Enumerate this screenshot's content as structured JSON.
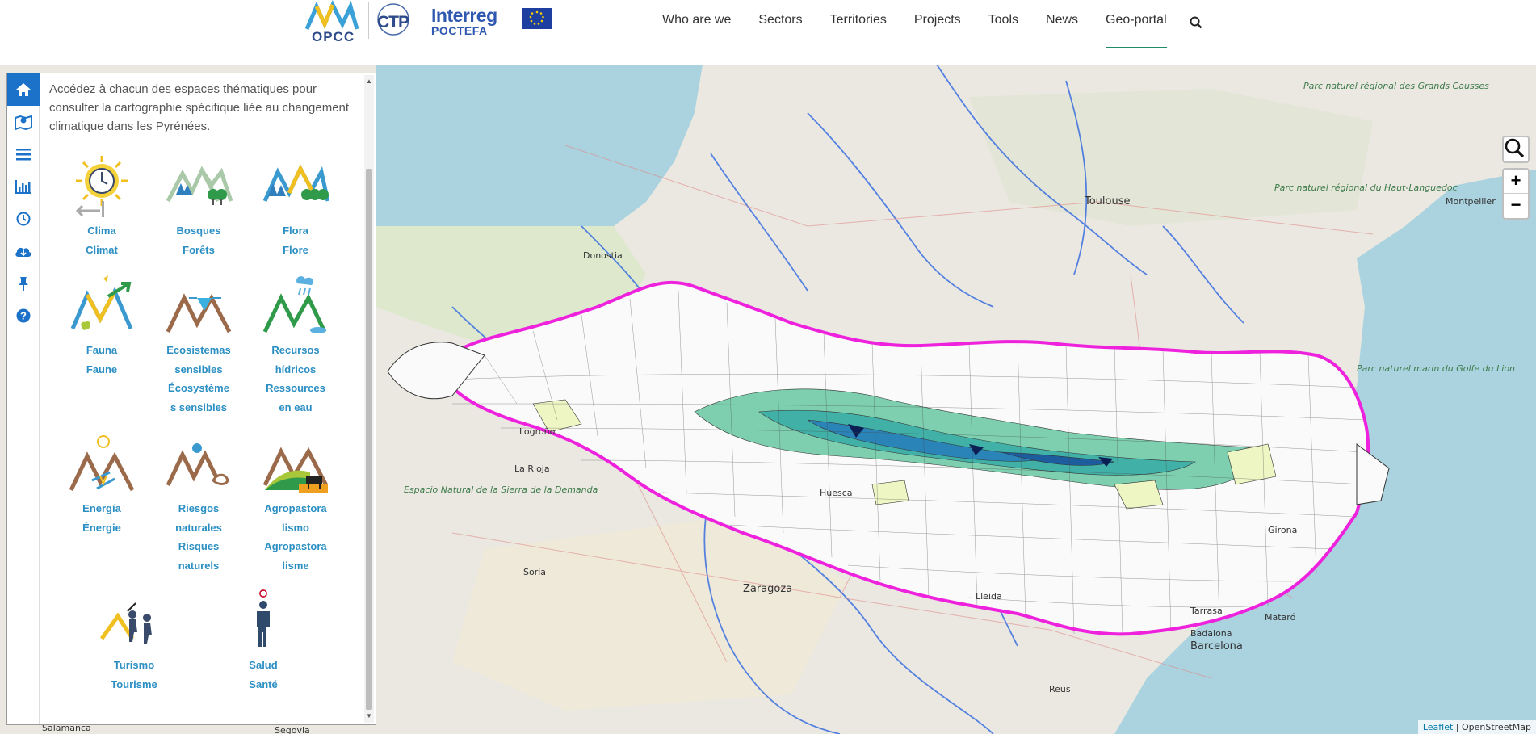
{
  "header": {
    "logo_opcc": "OPCC",
    "logo_ctp": "CTP",
    "logo_interreg_1": "Interreg",
    "logo_interreg_2": "POCTEFA",
    "nav": [
      {
        "label": "Who are we"
      },
      {
        "label": "Sectors"
      },
      {
        "label": "Territories"
      },
      {
        "label": "Projects"
      },
      {
        "label": "Tools"
      },
      {
        "label": "News"
      },
      {
        "label": "Geo-portal"
      }
    ],
    "active_nav": "Geo-portal",
    "search_icon": "search-icon"
  },
  "panel": {
    "tabs": [
      {
        "icon": "home-icon"
      },
      {
        "icon": "map-marker-icon"
      },
      {
        "icon": "list-icon"
      },
      {
        "icon": "bar-chart-icon"
      },
      {
        "icon": "clock-icon"
      },
      {
        "icon": "cloud-download-icon"
      },
      {
        "icon": "pin-icon"
      },
      {
        "icon": "help-icon"
      }
    ],
    "intro": "Accédez à chacun des espaces thématiques pour consulter la cartographie spécifique liée au changement climatique dans les Pyrénées.",
    "themes": [
      {
        "lines": [
          "Clima",
          "Climat"
        ],
        "icon": "climate-icon"
      },
      {
        "lines": [
          "Bosques",
          "Forêts"
        ],
        "icon": "forest-icon"
      },
      {
        "lines": [
          "Flora",
          "Flore"
        ],
        "icon": "flora-icon"
      },
      {
        "lines": [
          "Fauna",
          "Faune"
        ],
        "icon": "fauna-icon"
      },
      {
        "lines": [
          "Ecosistemas",
          "sensibles",
          "Écosystème",
          "s sensibles"
        ],
        "icon": "ecosystems-icon"
      },
      {
        "lines": [
          "Recursos",
          "hídricos",
          "Ressources",
          "en eau"
        ],
        "icon": "water-resources-icon"
      },
      {
        "lines": [
          "Energía",
          "Énergie"
        ],
        "icon": "energy-icon"
      },
      {
        "lines": [
          "Riesgos",
          "naturales",
          "Risques",
          "naturels"
        ],
        "icon": "natural-risks-icon"
      },
      {
        "lines": [
          "Agropastora",
          "lismo",
          "Agropastora",
          "lisme"
        ],
        "icon": "agropastoralism-icon"
      },
      {
        "lines": [
          "Turismo",
          "Tourisme"
        ],
        "icon": "tourism-icon"
      },
      {
        "lines": [
          "Salud",
          "Santé"
        ],
        "icon": "health-icon"
      }
    ]
  },
  "map": {
    "zoom_in": "+",
    "zoom_out": "−",
    "attribution_leaflet": "Leaflet",
    "attribution_osm": " | OpenStreetMap",
    "places": [
      {
        "name": "Toulouse",
        "cls": "big"
      },
      {
        "name": "Donostia"
      },
      {
        "name": "Montpellier"
      },
      {
        "name": "Logroño"
      },
      {
        "name": "La Rioja"
      },
      {
        "name": "Huesca"
      },
      {
        "name": "Soria"
      },
      {
        "name": "Zaragoza",
        "cls": "big"
      },
      {
        "name": "Lleida"
      },
      {
        "name": "Girona"
      },
      {
        "name": "Tarrasa"
      },
      {
        "name": "Mataró"
      },
      {
        "name": "Badalona"
      },
      {
        "name": "Barcelona",
        "cls": "big"
      },
      {
        "name": "Reus"
      },
      {
        "name": "Salamanca"
      },
      {
        "name": "Segovia"
      }
    ],
    "parks": [
      "Parc naturel régional des Grands Causses",
      "Parc naturel régional du Haut-Languedoc",
      "Parc naturel marin du Golfe du Lion",
      "Espacio Natural de la Sierra de la Demanda"
    ]
  },
  "colors": {
    "accent_blue": "#1b72c8",
    "theme_label": "#2b8fc3",
    "region_border": "#ee22dd",
    "choropleth": [
      "#ffffff",
      "#eef6c4",
      "#7dcfb0",
      "#41b1a8",
      "#2a84b8",
      "#1d5d9e",
      "#0b1f55"
    ]
  }
}
